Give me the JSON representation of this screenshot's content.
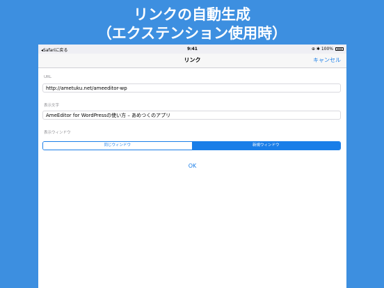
{
  "promo": {
    "line1": "リンクの自動生成",
    "line2": "（エクステンション使用時）"
  },
  "statusbar": {
    "back": "◂Safariに戻る",
    "time": "9:41",
    "right": "⊕ ✱ 100%"
  },
  "navbar": {
    "title": "リンク",
    "cancel": "キャンセル"
  },
  "form": {
    "url_label": "URL",
    "url_value": "http://ametuku.net/ameeditor-wp",
    "text_label": "表示文字",
    "text_value": "AmeEditor for WordPressの使い方 – あめつくのアプリ",
    "window_label": "表示ウィンドウ",
    "window_options": [
      "同じウィンドウ",
      "新規ウィンドウ"
    ],
    "window_selected": "新規ウィンドウ",
    "ok_label": "OK"
  },
  "colors": {
    "background": "#3d8fe0",
    "accent": "#1a7ee8"
  }
}
